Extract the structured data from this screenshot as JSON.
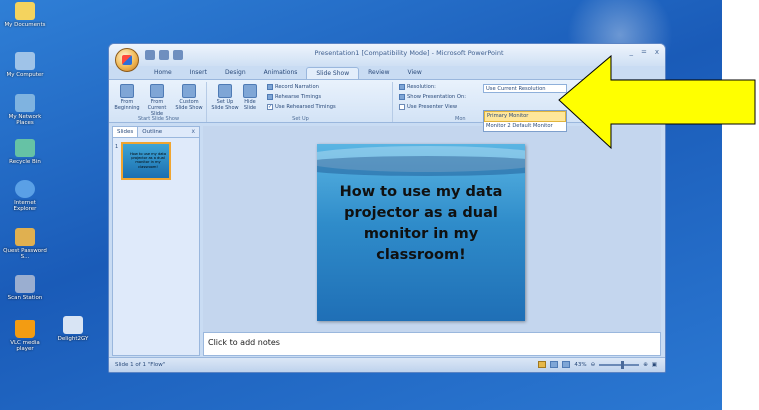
{
  "desktop": {
    "icons": [
      {
        "label": "My Documents",
        "icon": "folder-icon",
        "color": "#f4d35e"
      },
      {
        "label": "My Computer",
        "icon": "computer-icon",
        "color": "#9fc3e8"
      },
      {
        "label": "My Network Places",
        "icon": "network-icon",
        "color": "#7fb3e0"
      },
      {
        "label": "Recycle Bin",
        "icon": "recycle-bin-icon",
        "color": "#66c2a5"
      },
      {
        "label": "Internet Explorer",
        "icon": "internet-explorer-icon",
        "color": "#5aa0e6"
      },
      {
        "label": "Quest Password S...",
        "icon": "key-icon",
        "color": "#e0b050"
      },
      {
        "label": "Scan Station",
        "icon": "scanner-icon",
        "color": "#9aaed0"
      },
      {
        "label": "VLC media player",
        "icon": "vlc-cone-icon",
        "color": "#f39c12"
      },
      {
        "label": "Delight2GY",
        "icon": "document-icon",
        "color": "#d8e4f4"
      }
    ]
  },
  "window": {
    "title": "Presentation1 [Compatibility Mode] - Microsoft PowerPoint",
    "controls": [
      "_",
      "=",
      "x"
    ],
    "tabs": [
      "Home",
      "Insert",
      "Design",
      "Animations",
      "Slide Show",
      "Review",
      "View"
    ],
    "active_tab": "Slide Show",
    "ribbon": {
      "start_group": {
        "name": "Start Slide Show",
        "buttons": [
          "From Beginning",
          "From Current Slide",
          "Custom Slide Show"
        ]
      },
      "setup_group": {
        "name": "Set Up",
        "buttons": [
          "Set Up Slide Show",
          "Hide Slide"
        ],
        "small": [
          "Record Narration",
          "Rehearse Timings",
          "Use Rehearsed Timings"
        ]
      },
      "monitors_group": {
        "name": "Monitors",
        "name_visible": "Mon",
        "small": [
          "Resolution:",
          "Show Presentation On:",
          "Use Presenter View"
        ],
        "resolution_value": "Use Current Resolution",
        "monitor_options": [
          "Primary Monitor",
          "Monitor 2 Default Monitor"
        ],
        "selected_option": "Primary Monitor"
      }
    },
    "side_panel": {
      "tabs": [
        "Slides",
        "Outline"
      ],
      "close": "x",
      "slide_number": "1",
      "thumbnail_text": "How to use my data projector as a dual monitor in my classroom!"
    },
    "slide": {
      "title": "How to use my data projector as a dual monitor in my classroom!"
    },
    "notes_placeholder": "Click to add notes",
    "status": {
      "left": "Slide 1 of 1   \"Flow\"",
      "zoom": "43%"
    }
  },
  "annotation": {
    "arrow_color": "#ffff00",
    "arrow_outline": "#000000"
  }
}
